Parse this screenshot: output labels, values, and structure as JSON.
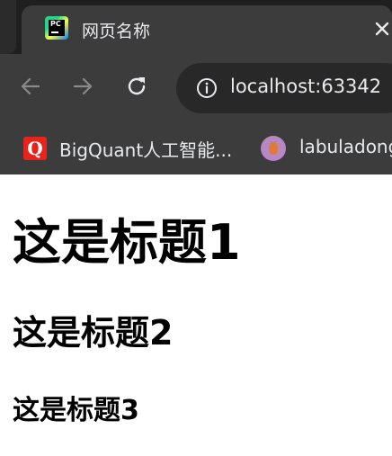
{
  "tab": {
    "title": "网页名称",
    "favicon_text": "PC"
  },
  "toolbar": {
    "url": "localhost:63342"
  },
  "bookmarks": [
    {
      "icon_text": "Q",
      "label": "BigQuant人工智能..."
    },
    {
      "label": "labuladong"
    }
  ],
  "content": {
    "h1": "这是标题1",
    "h2": "这是标题2",
    "h3": "这是标题3"
  },
  "colors": {
    "tabstrip_bg": "#1f1f1f",
    "toolbar_bg": "#3c3c3c",
    "omnibox_bg": "#282828",
    "text_light": "#e8eaed",
    "bigquant_red": "#e8231b",
    "page_bg": "#ffffff"
  }
}
